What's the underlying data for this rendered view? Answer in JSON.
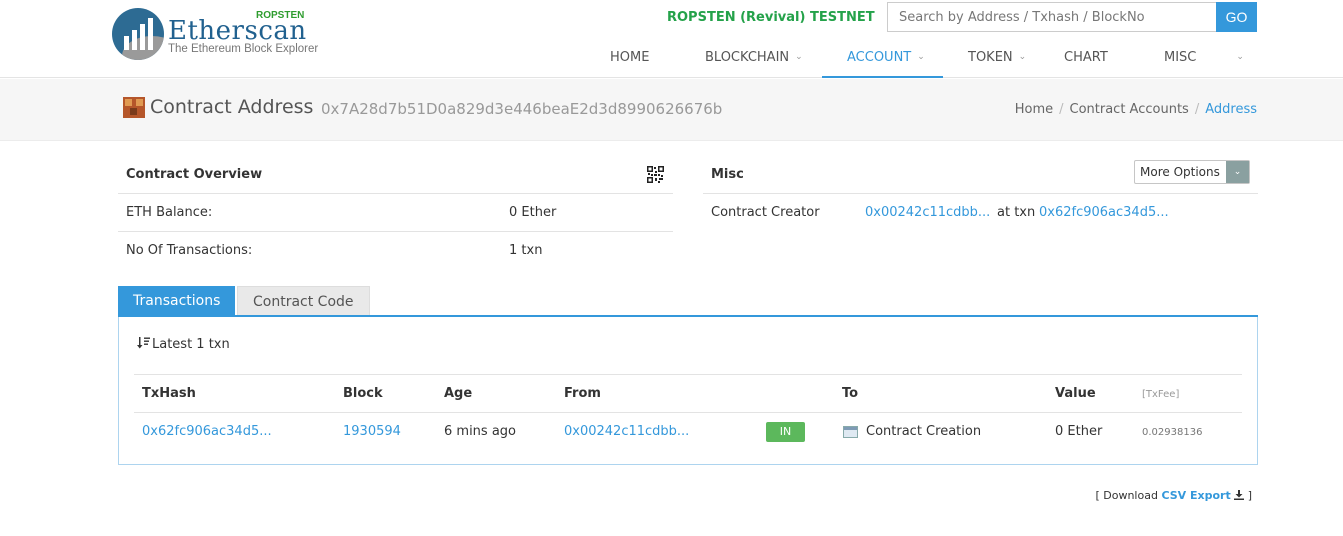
{
  "header": {
    "logo_word": "Etherscan",
    "logo_sub": "The Ethereum Block Explorer",
    "logo_network": "ROPSTEN",
    "testnet_label": "ROPSTEN (Revival) TESTNET",
    "search_placeholder": "Search by Address / Txhash / BlockNo",
    "go_label": "GO",
    "nav": [
      {
        "label": "HOME",
        "has_menu": false,
        "active": false
      },
      {
        "label": "BLOCKCHAIN",
        "has_menu": true,
        "active": false
      },
      {
        "label": "ACCOUNT",
        "has_menu": true,
        "active": true
      },
      {
        "label": "TOKEN",
        "has_menu": true,
        "active": false
      },
      {
        "label": "CHART",
        "has_menu": false,
        "active": false
      },
      {
        "label": "MISC",
        "has_menu": true,
        "active": false
      }
    ],
    "brand_color": "#3498db",
    "testnet_color": "#24a24a"
  },
  "page": {
    "title": "Contract Address",
    "address": "0x7A28d7b51D0a829d3e446beaE2d3d8990626676b",
    "breadcrumb": [
      "Home",
      "Contract Accounts",
      "Address"
    ]
  },
  "overview": {
    "title": "Contract Overview",
    "rows": [
      {
        "label": "ETH Balance:",
        "value": "0 Ether"
      },
      {
        "label": "No Of Transactions:",
        "value": "1 txn"
      }
    ]
  },
  "misc": {
    "title": "Misc",
    "more_options": "More Options",
    "creator_label": "Contract Creator",
    "creator_address": "0x00242c11cdbb...",
    "at_txn": "at txn",
    "creator_txn": "0x62fc906ac34d5..."
  },
  "tabs": [
    "Transactions",
    "Contract Code"
  ],
  "transactions": {
    "summary": "Latest 1 txn",
    "columns": [
      "TxHash",
      "Block",
      "Age",
      "From",
      "To",
      "Value",
      "[TxFee]"
    ],
    "rows": [
      {
        "txhash": "0x62fc906ac34d5...",
        "block": "1930594",
        "age": "6 mins ago",
        "from": "0x00242c11cdbb...",
        "direction": "IN",
        "to": "Contract Creation",
        "value": "0 Ether",
        "fee": "0.02938136"
      }
    ],
    "download_prefix": "[ Download",
    "csv_export": "CSV Export",
    "download_suffix": "]"
  }
}
